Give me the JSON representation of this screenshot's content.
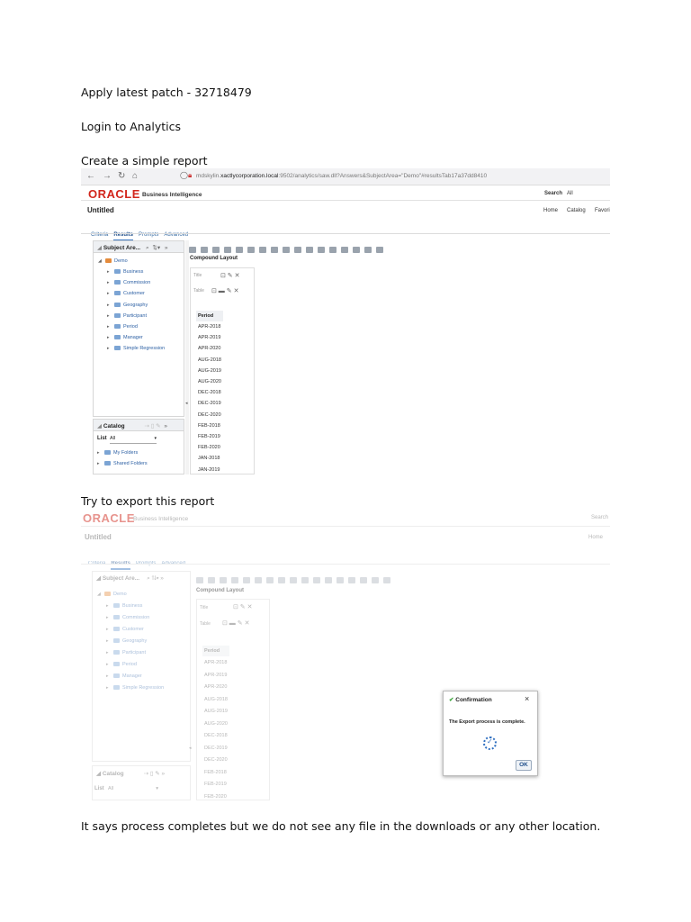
{
  "document": {
    "line1": "Apply latest patch - 32718479",
    "line2": "Login to Analytics",
    "line3": "Create  a simple report",
    "line4": "Try to export this report",
    "line5": "It says process completes but we do not see any file in the downloads or any other location."
  },
  "browser": {
    "url_prefix": "mdskylin.",
    "url_domain": "xactlycorporation.local",
    "url_suffix": ":9502/analytics/saw.dll?Answers&SubjectArea=\"Demo\"#resultsTab17a37dd8410"
  },
  "app": {
    "logo": "ORACLE",
    "product": "Business Intelligence",
    "search_label": "Search",
    "search_value": "All",
    "nav_home": "Home",
    "nav_catalog": "Catalog",
    "nav_favorites": "Favori",
    "page_title": "Untitled",
    "tabs": [
      "Criteria",
      "Results",
      "Prompts",
      "Advanced"
    ]
  },
  "subject_area": {
    "title": "Subject Are...",
    "root": "Demo",
    "folders": [
      "Business",
      "Commission",
      "Customer",
      "Geography",
      "Participant",
      "Period",
      "Manager",
      "Simple Regression"
    ]
  },
  "catalog": {
    "title": "Catalog",
    "list_label": "List",
    "list_value": "All",
    "folders": [
      "My Folders",
      "Shared Folders"
    ]
  },
  "layout": {
    "compound_layout": "Compound Layout",
    "title_view": "Title",
    "table_view": "Table"
  },
  "table": {
    "header": "Period",
    "rows1": [
      "APR-2018",
      "APR-2019",
      "APR-2020",
      "AUG-2018",
      "AUG-2019",
      "AUG-2020",
      "DEC-2018",
      "DEC-2019",
      "DEC-2020",
      "FEB-2018",
      "FEB-2019",
      "FEB-2020",
      "JAN-2018",
      "JAN-2019"
    ],
    "rows2": [
      "APR-2018",
      "APR-2019",
      "APR-2020",
      "AUG-2018",
      "AUG-2019",
      "AUG-2020",
      "DEC-2018",
      "DEC-2019",
      "DEC-2020",
      "FEB-2018",
      "FEB-2019",
      "FEB-2020"
    ]
  },
  "dialog": {
    "title": "Confirmation",
    "message": "The Export process is complete.",
    "ok": "OK"
  },
  "colors": {
    "oracle_red": "#d2261c",
    "link_blue": "#2b5fa3",
    "dialog_check": "#3aa53a"
  }
}
